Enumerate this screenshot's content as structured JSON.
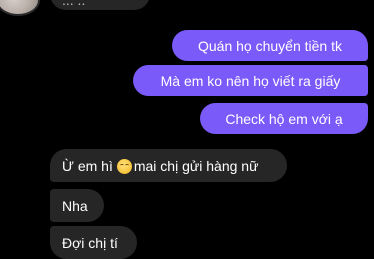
{
  "thread": {
    "top_received_partial": "... ..",
    "messages_sent": [
      "Quán họ chuyển tiền tk",
      "Mà em ko nên họ viết ra giấy",
      "Check hộ em với ạ"
    ],
    "messages_received": [
      {
        "before_emoji": "Ừ em hì",
        "emoji": "smiling-blush-emoji",
        "after_emoji": "mai chị gửi hàng nữ"
      },
      {
        "text": "Nha"
      },
      {
        "text": "Đợi chị tí"
      }
    ]
  },
  "colors": {
    "background": "#000000",
    "sent_bubble": "#7a5af8",
    "received_bubble": "#262626"
  }
}
